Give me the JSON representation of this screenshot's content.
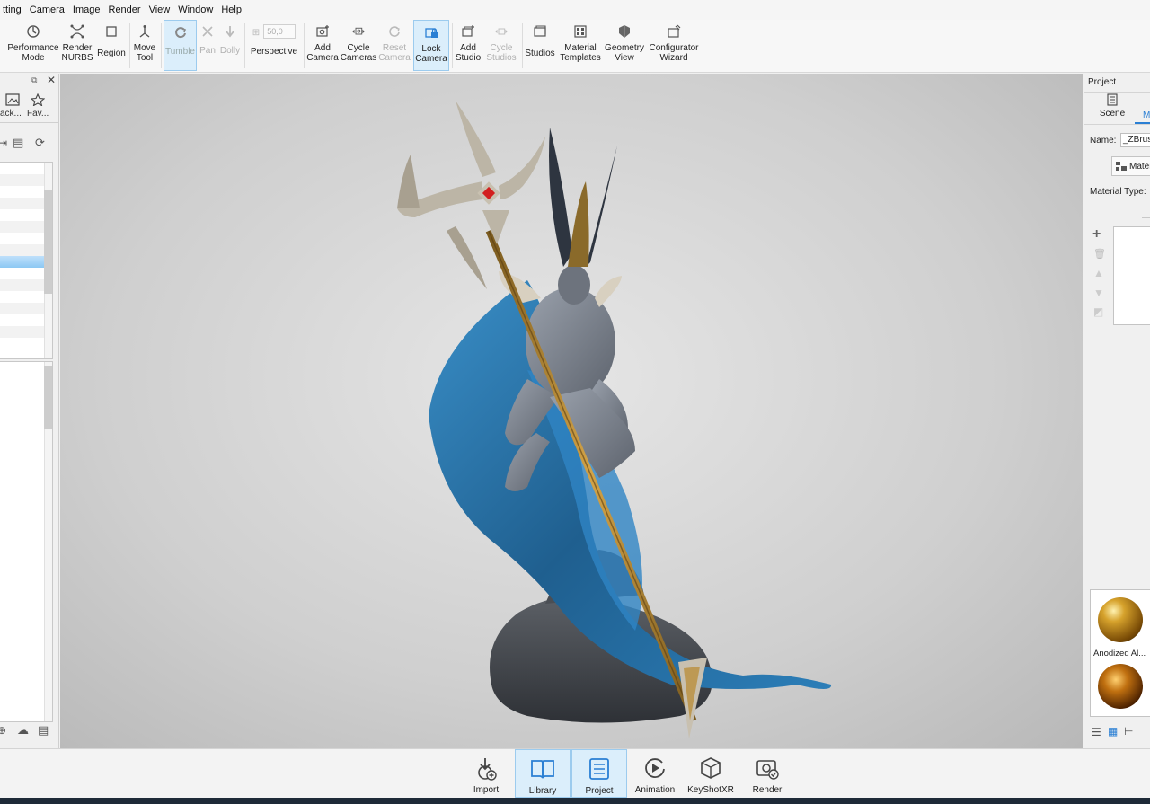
{
  "menu": [
    "tting",
    "Camera",
    "Image",
    "Render",
    "View",
    "Window",
    "Help"
  ],
  "ribbon": {
    "performance_mode": "Performance\nMode",
    "render_nurbs": "Render\nNURBS",
    "region": "Region",
    "move_tool": "Move\nTool",
    "tumble": "Tumble",
    "pan": "Pan",
    "dolly": "Dolly",
    "fov_value": "50,0",
    "perspective": "Perspective",
    "add_camera": "Add\nCamera",
    "cycle_cameras": "Cycle\nCameras",
    "reset_camera": "Reset\nCamera",
    "lock_camera": "Lock\nCamera",
    "add_studio": "Add\nStudio",
    "cycle_studios": "Cycle\nStudios",
    "studios": "Studios",
    "material_templates": "Material\nTemplates",
    "geometry_view": "Geometry\nView",
    "configurator_wizard": "Configurator\nWizard"
  },
  "left_panel": {
    "tab_back": "ack...",
    "tab_favorites": "Fav..."
  },
  "right_panel": {
    "title": "Project",
    "tab_scene": "Scene",
    "tab_material": "M",
    "name_label": "Name:",
    "name_value": "_ZBrush",
    "material_button": "Mater",
    "material_type_label": "Material Type:",
    "swatch_1_label": "Anodized Al..."
  },
  "bottom": {
    "import": "Import",
    "library": "Library",
    "project": "Project",
    "animation": "Animation",
    "keyshotxr": "KeyShotXR",
    "render": "Render"
  },
  "colors": {
    "accent": "#2a7fd4",
    "active_bg": "#dbeefb",
    "cloth": "#1f5f8f",
    "skin": "#7d8490",
    "gold": "#b8892e"
  }
}
